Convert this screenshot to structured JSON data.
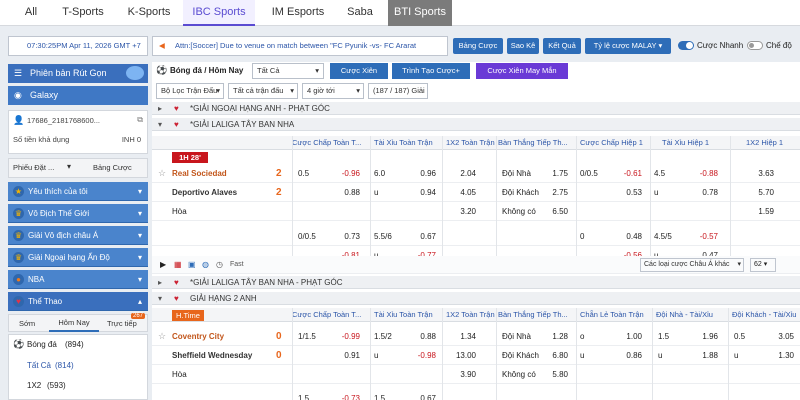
{
  "topnav": {
    "tabs": [
      "All",
      "T-Sports",
      "K-Sports",
      "IBC Sports",
      "IM Esports",
      "Saba",
      "BTI Sports"
    ],
    "active": "IBC Sports"
  },
  "toolbar": {
    "datetime": "07:30:25PM Apr 11, 2026 GMT +7",
    "notice": "Attn:[Soccer] Due to venue on match between \"FC Pyunik -vs- FC Ararat",
    "btn_bang_cuoc": "Bảng Cược",
    "btn_sao_ke": "Sao Kê",
    "btn_ket_qua": "Kết Quả",
    "odds_type": "Tỷ lệ cược MALAY",
    "toggle_fast": "Cược Nhanh",
    "toggle_mode": "Chế độ"
  },
  "sidebar": {
    "btn_cashout": "Phiên bản Rút Gọn",
    "btn_galaxy": "Galaxy",
    "account_id": "17686_2181768600...",
    "balance_label": "Số tiền khả dụng",
    "balance_value": "INH 0",
    "tab_slip": "Phiếu Đặt ...",
    "tab_bets": "Bảng Cược",
    "categories": [
      {
        "label": "Yêu thích của tôi",
        "icon": "star-icon"
      },
      {
        "label": "Vô Địch Thế Giới",
        "icon": "trophy-icon"
      },
      {
        "label": "Giải Vô địch châu Á",
        "icon": "trophy-icon"
      },
      {
        "label": "Giải Ngoại hạng Ấn Độ",
        "icon": "trophy-icon"
      },
      {
        "label": "NBA",
        "icon": "basketball-icon"
      },
      {
        "label": "Thể Thao",
        "icon": "heart-icon"
      }
    ],
    "time_tabs": [
      "Sớm",
      "Hôm Nay",
      "Trực tiếp"
    ],
    "live_count": "267",
    "sport": "Bóng đá",
    "sport_count": "(894)",
    "markets": [
      {
        "label": "Tất Cả",
        "count": "(814)"
      },
      {
        "label": "1X2",
        "count": "(593)"
      }
    ]
  },
  "main": {
    "header": {
      "title": "Bóng đá / Hôm Nay",
      "filter": "Tất Cả",
      "btn_cuoc_xien": "Cược Xiên",
      "btn_tao_cuoc": "Trình Tạo Cược+",
      "btn_xien_may_man": "Cược Xiên May Mắn"
    },
    "filters": {
      "loc": "Bộ Lọc Trận Đấu",
      "tat_ca": "Tất cả trận đấu",
      "hours": "4 giờ tới",
      "count": "(187 / 187) Giải"
    },
    "leagues": [
      "*GIẢI NGOẠI HẠNG ANH - PHẠT GÓC",
      "*GIẢI LALIGA TÂY BAN NHA",
      "*GIẢI LALIGA TÂY BAN NHA - PHẠT GÓC",
      "GIẢI HẠNG 2 ANH"
    ],
    "columns1": [
      "Cược Chấp Toàn T...",
      "Tài Xỉu Toàn Trận",
      "1X2 Toàn Trận",
      "Bàn Thắng Tiếp Th...",
      "Cược Chấp Hiệp 1",
      "Tài Xỉu Hiệp 1",
      "1X2 Hiệp 1"
    ],
    "columns2": [
      "Cược Chấp Toàn T...",
      "Tài Xỉu Toàn Trận",
      "1X2 Toàn Trận",
      "Bàn Thắng Tiếp Th...",
      "Chẵn Lẻ Toàn Trận",
      "Đội Nhà - Tài/Xỉu",
      "Đội Khách - Tài/Xỉu"
    ],
    "match1": {
      "status": "1H 28'",
      "home": "Real Sociedad",
      "home_score": "2",
      "away": "Deportivo Alaves",
      "away_score": "2",
      "draw": "Hòa",
      "r1": [
        "0.5",
        "-0.96",
        "6.0",
        "0.96",
        "2.04",
        "Đội Nhà",
        "1.75",
        "0/0.5",
        "-0.61",
        "4.5",
        "-0.88",
        "3.63"
      ],
      "r2": [
        "0.88",
        "u",
        "0.94",
        "4.05",
        "Đội Khách",
        "2.75",
        "0.53",
        "u",
        "0.78",
        "5.70"
      ],
      "r3": [
        "3.20",
        "Không có",
        "6.50",
        "1.59"
      ],
      "alt1": [
        "0/0.5",
        "0.73",
        "5.5/6",
        "0.67",
        "0",
        "0.48",
        "4.5/5",
        "-0.57"
      ],
      "alt2": [
        "-0.81",
        "u",
        "-0.77",
        "-0.56",
        "u",
        "0.47"
      ],
      "fast": "Fast",
      "other": "Các loại cược Châu Á khác",
      "other_count": "62"
    },
    "match2": {
      "status": "H.Time",
      "home": "Coventry City",
      "home_score": "0",
      "away": "Sheffield Wednesday",
      "away_score": "0",
      "draw": "Hòa",
      "r1": [
        "1/1.5",
        "-0.99",
        "1.5/2",
        "0.88",
        "1.34",
        "Đội Nhà",
        "1.28",
        "o",
        "1.00",
        "1.5",
        "1.96",
        "0.5",
        "3.05"
      ],
      "r2": [
        "0.91",
        "u",
        "-0.98",
        "13.00",
        "Đội Khách",
        "6.80",
        "u",
        "0.86",
        "u",
        "1.88",
        "u",
        "1.30"
      ],
      "r3": [
        "3.90",
        "Không có",
        "5.80"
      ],
      "alt1": [
        "1.5",
        "-0.73",
        "1.5",
        "0.67"
      ]
    }
  }
}
